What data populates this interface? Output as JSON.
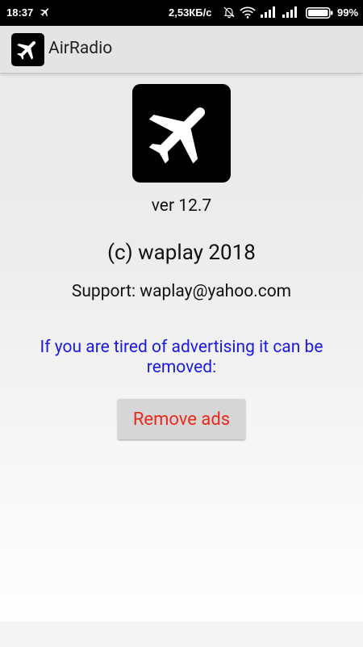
{
  "status_bar": {
    "time": "18:37",
    "left_icon": "airplane-icon",
    "network_speed": "2,53КБ/с",
    "battery_percent": "99%",
    "icons": [
      "bell-off-icon",
      "wifi-icon",
      "signal-icon",
      "signal-icon",
      "battery-icon"
    ]
  },
  "action_bar": {
    "app_icon": "airplane-icon",
    "title": "AirRadio"
  },
  "about": {
    "logo_icon": "airplane-icon",
    "version": "ver 12.7",
    "copyright": "(c) waplay 2018",
    "support": "Support: waplay@yahoo.com",
    "ads_message": "If you are tired of advertising it can be removed:",
    "remove_ads_label": "Remove ads"
  },
  "colors": {
    "ads_message": "#1a1ae6",
    "remove_ads_text": "#e8291c",
    "button_bg": "#d6d6d6",
    "action_bar_bg": "#e4e4e4"
  }
}
